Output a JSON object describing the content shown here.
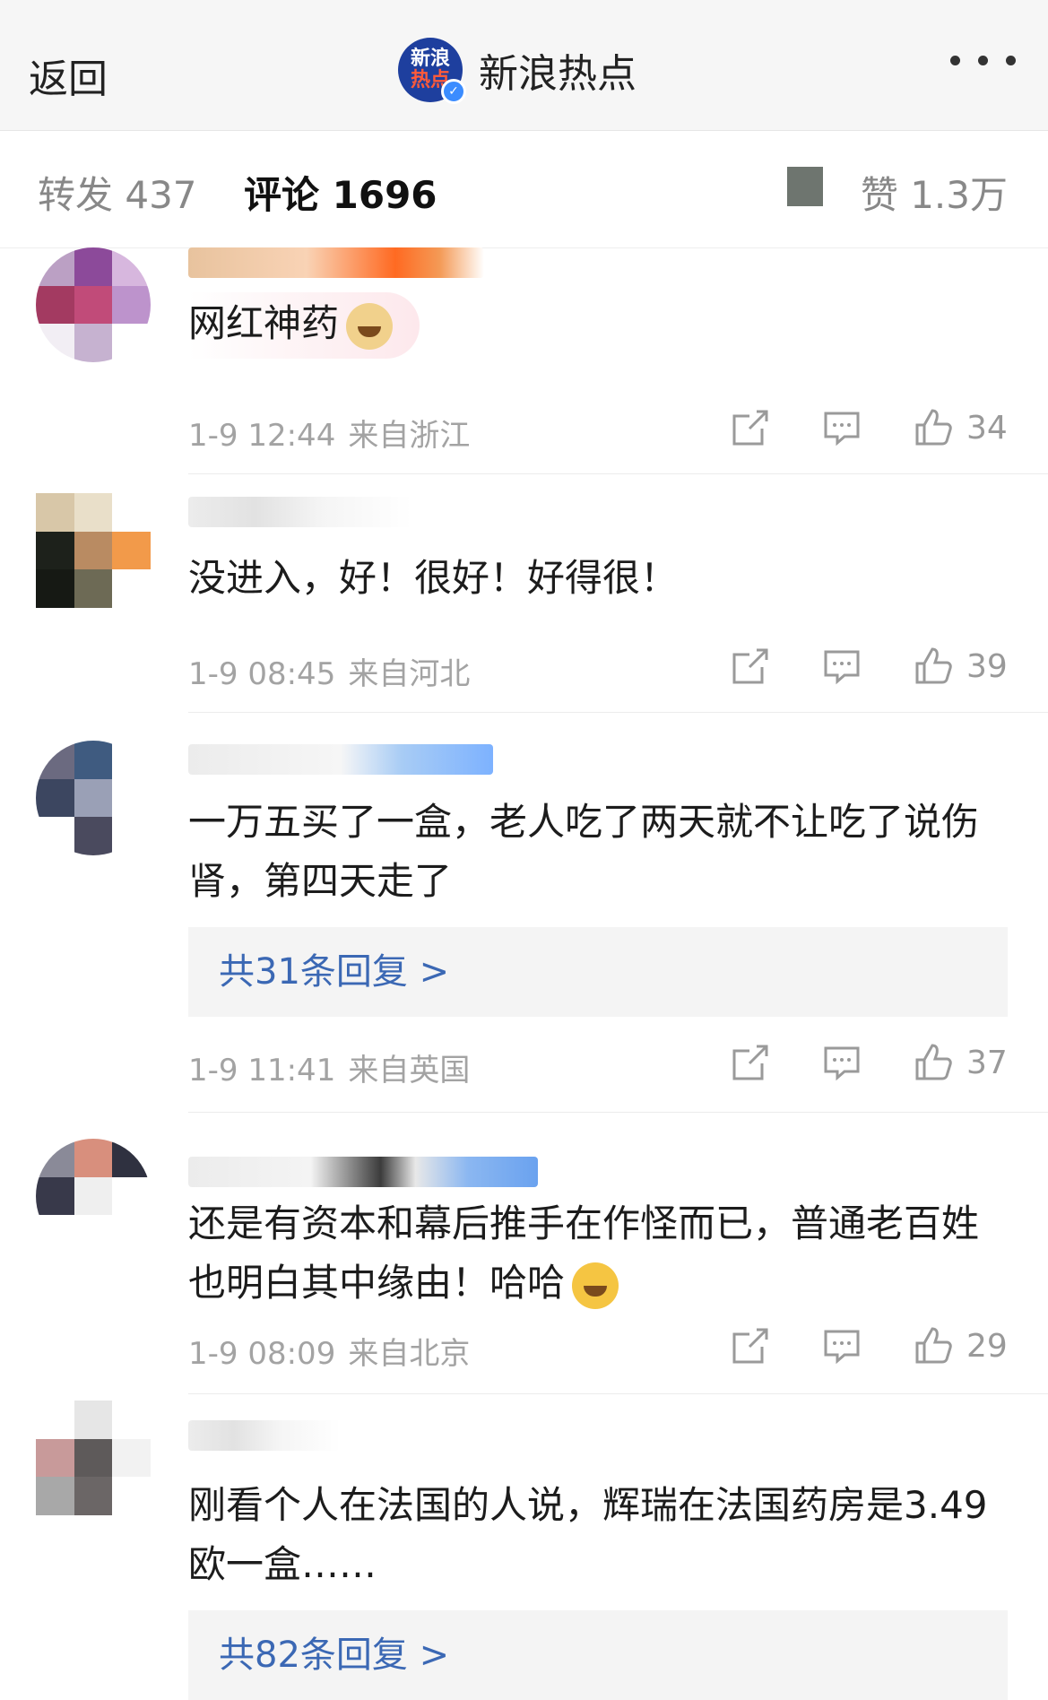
{
  "topbar": {
    "back_label": "返回",
    "account_logo_line1": "新浪",
    "account_logo_line2": "热点",
    "account_name": "新浪热点"
  },
  "tabs": {
    "repost": "转发 437",
    "comment": "评论 1696",
    "like": "赞 1.3万"
  },
  "comments": [
    {
      "text": "网红神药",
      "time": "1-9 12:44",
      "source": "来自浙江",
      "likes": "34"
    },
    {
      "text": "没进入，好！很好！好得很！",
      "time": "1-9 08:45",
      "source": "来自河北",
      "likes": "39"
    },
    {
      "text": "一万五买了一盒，老人吃了两天就不让吃了说伤肾，第四天走了",
      "replies": "共31条回复 >",
      "time": "1-9 11:41",
      "source": "来自英国",
      "likes": "37"
    },
    {
      "text": "还是有资本和幕后推手在作怪而已，普通老百姓也明白其中缘由！哈哈",
      "time": "1-9 08:09",
      "source": "来自北京",
      "likes": "29"
    },
    {
      "text": "刚看个人在法国的人说，辉瑞在法国药房是3.49欧一盒……",
      "replies": "共82条回复 >"
    }
  ],
  "colors": {
    "accent_link": "#3b68b4",
    "meta_gray": "#a3a3a3",
    "logo_blue": "#1e3f9e"
  },
  "icons": [
    "more-dots-icon",
    "share-icon",
    "comment-icon",
    "like-icon",
    "verified-badge-icon"
  ]
}
